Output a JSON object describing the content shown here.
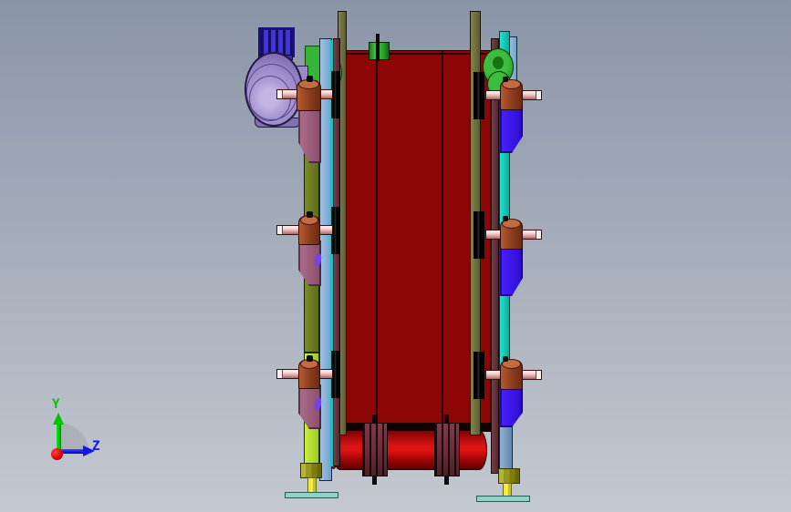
{
  "scene": {
    "type": "cad-3d-viewport",
    "view": "front orthographic view of a belt conveyor assembly"
  },
  "axis_triad": {
    "y_label": "Y",
    "z_label": "Z"
  },
  "colors": {
    "bg_top": "#8a95a7",
    "bg_bottom": "#c4c8d0",
    "belt": "#8e0505",
    "belt_edge": "#1b0303",
    "roller_mid": "#e01212",
    "coupling": "#6f2f3a",
    "post_light": "#83834f",
    "post_dark": "#5d5d2c",
    "rail_olive_light": "#7c8b29",
    "rail_olive_dark": "#5e6c19",
    "rail_chartreuse_light": "#c9ee42",
    "rail_chartreuse_dark": "#a0ca20",
    "plate_lightblue_light": "#9ec2e6",
    "plate_lightblue_dark": "#74a0ca",
    "teal_sliver": "#17c3c3",
    "strip_maroon_light": "#754149",
    "strip_maroon_dark": "#54252e",
    "rail_cyan_light": "#26e2ce",
    "rail_cyan_dark": "#08ae9e",
    "plate_steel_light": "#90b3d3",
    "plate_steel_dark": "#5e87ad",
    "bracket_mauve_light": "#ac6e8c",
    "bracket_mauve_dark": "#8a4d6a",
    "bracket_blue_light": "#4a22ff",
    "bracket_blue_dark": "#2d0bce",
    "rod_light": "#fae4e4",
    "rod_mid": "#eebbbb",
    "rod_dark": "#bb8181",
    "bushing_light": "#b25b35",
    "bushing_dark": "#6d2b11",
    "bushing_top": "#c56b41",
    "motor_outer": "#7f6eb0",
    "motor_mid": "#9b8ac6",
    "motor_light": "#c3b4e2",
    "junction_light": "#4134d8",
    "junction_dark": "#140e66",
    "pulley_green_light": "#3dbd3d",
    "pulley_green_dark": "#1d8a1d",
    "gearbox_green": "#35b535",
    "sensor_green_light": "#3ac43a",
    "sensor_green_dark": "#1a7e1a",
    "salmon_plate": "#e49aa6",
    "nut_light": "#b5b33b",
    "nut_dark": "#7f7d08",
    "leg_yellow_light": "#f4ec2a",
    "leg_yellow_dark": "#cdc506",
    "foot_teal": "#8fd2ca",
    "accent_violet": "#7a40f0",
    "axis_y": "#00c400",
    "axis_z": "#1414e8",
    "axis_x": "#d80000",
    "axis_arc": "#a8acb4"
  }
}
